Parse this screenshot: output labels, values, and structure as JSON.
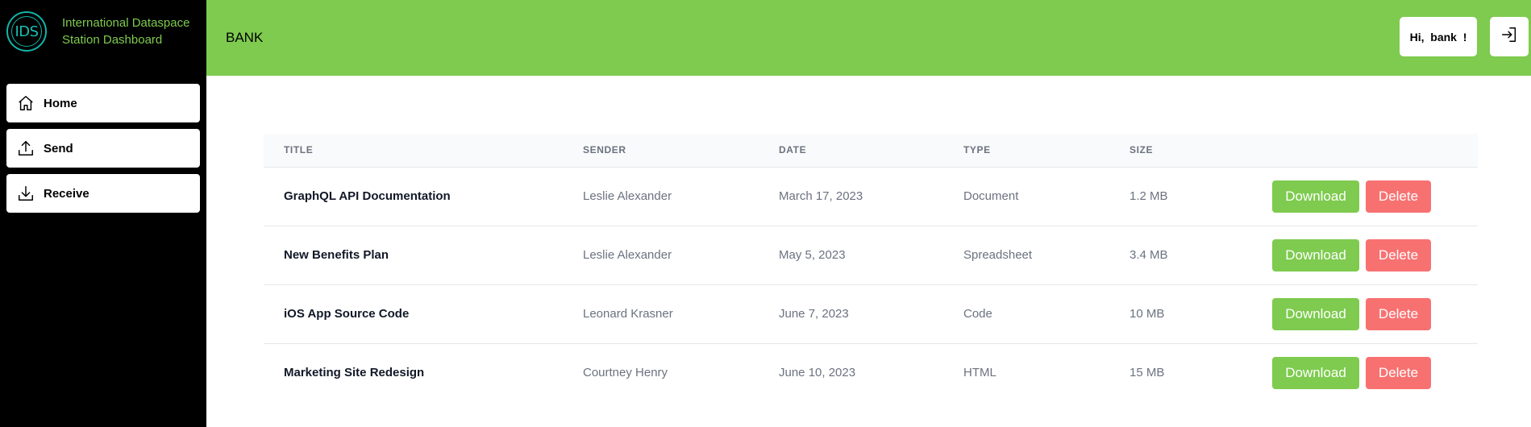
{
  "brand": {
    "logo_text": "IDS",
    "name": "International Dataspace Station Dashboard"
  },
  "sidebar": {
    "items": [
      {
        "label": "Home",
        "icon": "home-icon"
      },
      {
        "label": "Send",
        "icon": "upload-icon"
      },
      {
        "label": "Receive",
        "icon": "download-icon"
      }
    ]
  },
  "header": {
    "org_name": "BANK",
    "greeting": "Hi,  bank  !",
    "logout_icon": "logout-icon"
  },
  "table": {
    "columns": [
      "Title",
      "Sender",
      "Date",
      "Type",
      "Size"
    ],
    "rows": [
      {
        "title": "GraphQL API Documentation",
        "sender": "Leslie Alexander",
        "date": "March 17, 2023",
        "type": "Document",
        "size": "1.2 MB"
      },
      {
        "title": "New Benefits Plan",
        "sender": "Leslie Alexander",
        "date": "May 5, 2023",
        "type": "Spreadsheet",
        "size": "3.4 MB"
      },
      {
        "title": "iOS App Source Code",
        "sender": "Leonard Krasner",
        "date": "June 7, 2023",
        "type": "Code",
        "size": "10 MB"
      },
      {
        "title": "Marketing Site Redesign",
        "sender": "Courtney Henry",
        "date": "June 10, 2023",
        "type": "HTML",
        "size": "15 MB"
      }
    ],
    "download_label": "Download",
    "delete_label": "Delete"
  },
  "colors": {
    "accent": "#7ecb4f",
    "danger": "#f87171",
    "sidebar_bg": "#000000",
    "logo": "#19c0b2"
  }
}
